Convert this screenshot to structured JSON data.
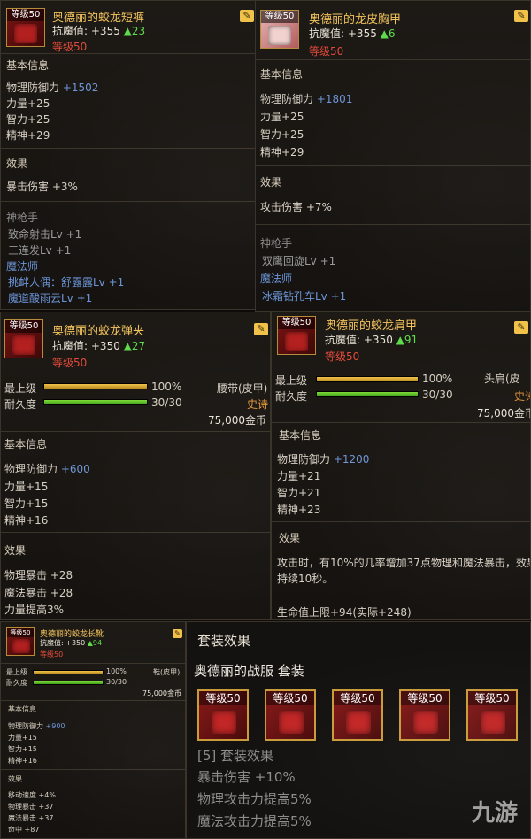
{
  "p1": {
    "lv_badge": "等级50",
    "name": "奥德丽的蛟龙短裤",
    "resist_label": "抗魔值:",
    "resist_value": "+355",
    "resist_gain": "▲23",
    "level": "等级50",
    "basic_title": "基本信息",
    "phys_def_label": "物理防御力",
    "phys_def_value": "+1502",
    "str": "力量+25",
    "int": "智力+25",
    "spi": "精神+29",
    "effect_title": "效果",
    "effect_1": "暴击伤害 +3%",
    "class_1": "神枪手",
    "skill_1": "致命射击Lv +1",
    "skill_2": "三连发Lv +1",
    "class_2": "魔法师",
    "skill_3": "挑衅人偶：舒露露Lv +1",
    "skill_4": "魔道酸雨云Lv +1"
  },
  "p2": {
    "lv_badge": "等级50",
    "name": "奥德丽的龙皮胸甲",
    "resist_label": "抗魔值:",
    "resist_value": "+355",
    "resist_gain": "▲6",
    "level": "等级50",
    "basic_title": "基本信息",
    "phys_def_label": "物理防御力",
    "phys_def_value": "+1801",
    "str": "力量+25",
    "int": "智力+25",
    "spi": "精神+29",
    "effect_title": "效果",
    "effect_1": "攻击伤害 +7%",
    "class_1": "神枪手",
    "skill_1": "双鹰回旋Lv +1",
    "class_2": "魔法师",
    "skill_2": "冰霜钻孔车Lv +1"
  },
  "p3": {
    "lv_badge": "等级50",
    "name": "奥德丽的蛟龙弹夹",
    "resist_label": "抗魔值:",
    "resist_value": "+350",
    "resist_gain": "▲27",
    "level": "等级50",
    "max_level_label": "最上级",
    "max_level_pct": "100%",
    "max_level_fraction": 1.0,
    "durability_label": "耐久度",
    "durability_value": "30/30",
    "durability_fraction": 1.0,
    "slot_type": "腰带(皮甲)",
    "rarity": "史诗",
    "price": "75,000金币",
    "basic_title": "基本信息",
    "phys_def_label": "物理防御力",
    "phys_def_value": "+600",
    "str": "力量+15",
    "int": "智力+15",
    "spi": "精神+16",
    "effect_title": "效果",
    "effect_1": "物理暴击 +28",
    "effect_2": "魔法暴击 +28",
    "effect_3": "力量提高3%"
  },
  "p4": {
    "lv_badge": "等级50",
    "name": "奥德丽的蛟龙肩甲",
    "resist_label": "抗魔值:",
    "resist_value": "+350",
    "resist_gain": "▲91",
    "level": "等级50",
    "max_level_label": "最上级",
    "max_level_pct": "100%",
    "max_level_fraction": 1.0,
    "durability_label": "耐久度",
    "durability_value": "30/30",
    "durability_fraction": 1.0,
    "slot_type": "头肩(皮",
    "rarity": "史诗",
    "price": "75,000金币",
    "basic_title": "基本信息",
    "phys_def_label": "物理防御力",
    "phys_def_value": "+1200",
    "str": "力量+21",
    "int": "智力+21",
    "spi": "精神+23",
    "effect_title": "效果",
    "effect_line_1": "攻击时，有10%的几率增加37点物理和魔法暴击，效果",
    "effect_line_2": "持续10秒。",
    "effect_hp": "生命值上限+94(实际+248)"
  },
  "p5": {
    "lv_badge": "等级50",
    "name": "奥德丽的蛟龙长靴",
    "resist_label": "抗魔值:",
    "resist_value": "+350",
    "resist_gain": "▲94",
    "level": "等级50",
    "max_level_label": "最上级",
    "max_level_pct": "100%",
    "max_level_fraction": 1.0,
    "durability_label": "耐久度",
    "durability_value": "30/30",
    "durability_fraction": 1.0,
    "slot_type": "鞋(皮甲)",
    "price": "75,000金币",
    "basic_title": "基本信息",
    "phys_def_label": "物理防御力",
    "phys_def_value": "+900",
    "str": "力量+15",
    "int": "智力+15",
    "spi": "精神+16",
    "effect_title": "效果",
    "effect_1": "移动速度 +4%",
    "effect_2": "物理暴击 +37",
    "effect_3": "魔法暴击 +37",
    "effect_4": "命中 +87"
  },
  "set": {
    "title": "套装效果",
    "name": "奥德丽的战服  套装",
    "slots": [
      "等级50",
      "等级50",
      "等级50",
      "等级50",
      "等级50"
    ],
    "count_line": "[5] 套装效果",
    "eff_1": "暴击伤害 +10%",
    "eff_2": "物理攻击力提高5%",
    "eff_3": "魔法攻击力提高5%"
  },
  "watermark": "九游",
  "colors": {
    "name_gold": "#f3c35c",
    "level_red": "#e34a3a",
    "gain_green": "#5fdc4b",
    "stat_blue": "#6f95d6",
    "rarity_orange": "#e89a3c"
  }
}
